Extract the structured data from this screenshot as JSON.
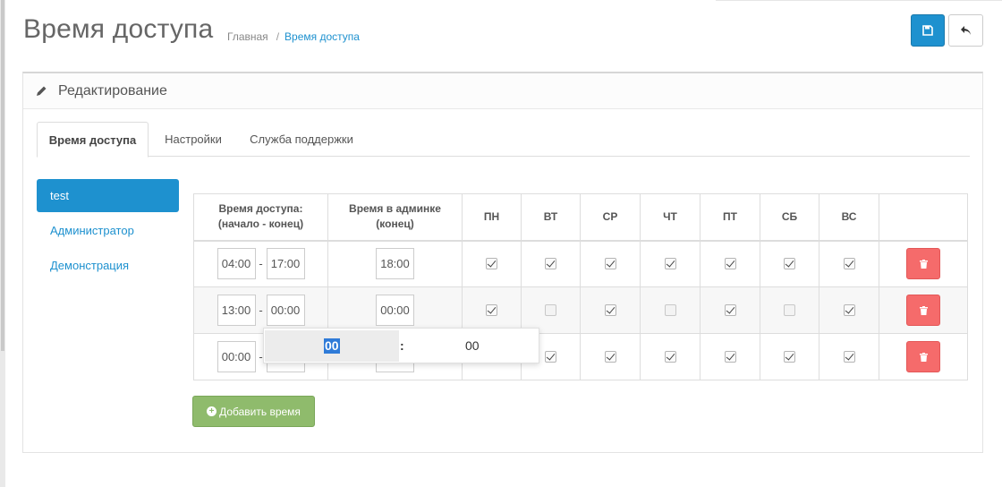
{
  "header": {
    "title": "Время доступа",
    "breadcrumb": [
      {
        "label": "Главная"
      },
      {
        "label": "Время доступа"
      }
    ]
  },
  "panel": {
    "title": "Редактирование"
  },
  "tabs": [
    {
      "label": "Время доступа",
      "active": true
    },
    {
      "label": "Настройки",
      "active": false
    },
    {
      "label": "Служба поддержки",
      "active": false
    }
  ],
  "groups": [
    {
      "label": "test",
      "active": true
    },
    {
      "label": "Администратор",
      "active": false
    },
    {
      "label": "Демонстрация",
      "active": false
    }
  ],
  "table": {
    "headers": {
      "access": "Время доступа:\n(начало - конец)",
      "admin": "Время в админке\n(конец)",
      "days": [
        "ПН",
        "ВТ",
        "СР",
        "ЧТ",
        "ПТ",
        "СБ",
        "ВС"
      ]
    },
    "rows": [
      {
        "start": "04:00",
        "end": "17:00",
        "admin": "18:00",
        "days": [
          true,
          true,
          true,
          true,
          true,
          true,
          true
        ]
      },
      {
        "start": "13:00",
        "end": "00:00",
        "admin": "00:00",
        "days": [
          true,
          false,
          true,
          false,
          true,
          false,
          true
        ]
      },
      {
        "start": "00:00",
        "end": "",
        "admin": "",
        "days": [
          null,
          true,
          true,
          true,
          true,
          true,
          true
        ]
      }
    ]
  },
  "add_button": {
    "label": "Добавить время"
  },
  "time_picker": {
    "hours": "00",
    "separator": ":",
    "minutes": "00"
  },
  "colors": {
    "primary": "#1e91cf",
    "danger": "#f56b6b",
    "success": "#8fbb6c"
  }
}
